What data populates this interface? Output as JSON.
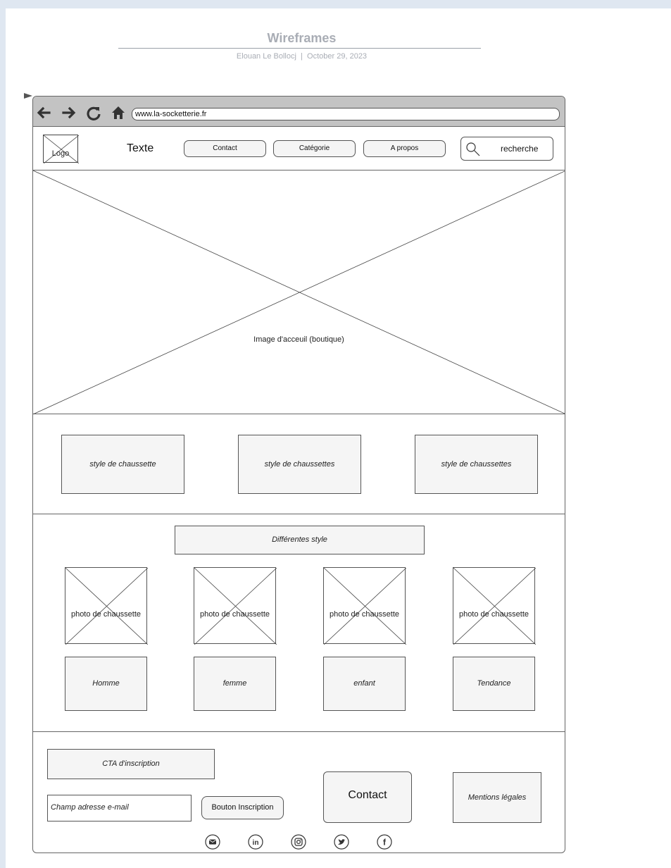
{
  "document": {
    "title": "Wireframes",
    "author": "Elouan Le Bollocj",
    "separator": "|",
    "date": "October 29, 2023"
  },
  "browser": {
    "url": "www.la-socketterie.fr",
    "nav_icons": [
      "back-arrow-icon",
      "forward-arrow-icon",
      "reload-icon",
      "home-icon"
    ]
  },
  "header": {
    "logo_label": "Logo",
    "text": "Texte",
    "nav": [
      {
        "label": "Contact"
      },
      {
        "label": "Catégorie"
      },
      {
        "label": "A propos"
      }
    ],
    "search_label": "recherche"
  },
  "hero": {
    "label": "Image d'acceuil (boutique)"
  },
  "styles": [
    {
      "label": "style de chaussette"
    },
    {
      "label": "style de chaussettes"
    },
    {
      "label": "style de chaussettes"
    }
  ],
  "different": {
    "title": "Différentes style",
    "photos": [
      {
        "label": "photo de chaussette"
      },
      {
        "label": "photo de chaussette"
      },
      {
        "label": "photo de chaussette"
      },
      {
        "label": "photo de chaussette"
      }
    ],
    "categories": [
      {
        "label": "Homme"
      },
      {
        "label": "femme"
      },
      {
        "label": "enfant"
      },
      {
        "label": "Tendance"
      }
    ]
  },
  "footer": {
    "cta": "CTA d'inscription",
    "email_field": "Champ adresse e-mail",
    "signup_button": "Bouton Inscription",
    "contact_button": "Contact",
    "legal": "Mentions légales",
    "social_icons": [
      "email-icon",
      "linkedin-icon",
      "instagram-icon",
      "twitter-icon",
      "facebook-icon"
    ]
  }
}
